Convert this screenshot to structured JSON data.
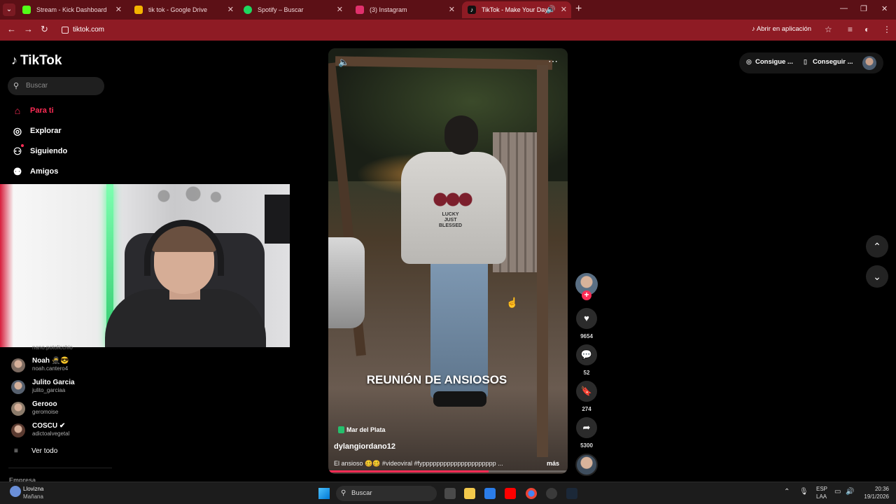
{
  "browser": {
    "tabs": [
      {
        "label": "Stream - Kick Dashboard",
        "favicon_color": "#53fc18"
      },
      {
        "label": "tik tok - Google Drive",
        "favicon_color": "#f4b400"
      },
      {
        "label": "Spotify – Buscar",
        "favicon_color": "#1ed760"
      },
      {
        "label": "(3) Instagram",
        "favicon_color": "#e1306c"
      },
      {
        "label": "TikTok - Make Your Day",
        "favicon_color": "#111111"
      }
    ],
    "url": "tiktok.com",
    "open_app_label": "Abrir en aplicación",
    "theme_color": "#8e1b24"
  },
  "sidebar": {
    "logo": "TikTok",
    "search_placeholder": "Buscar",
    "nav": [
      {
        "label": "Para ti",
        "icon": "home-icon"
      },
      {
        "label": "Explorar",
        "icon": "compass-icon"
      },
      {
        "label": "Siguiendo",
        "icon": "following-icon"
      },
      {
        "label": "Amigos",
        "icon": "friends-icon"
      }
    ],
    "faded_username": "nano.potolicchio",
    "accounts": [
      {
        "name": "Noah 🥷😎",
        "username": "noah.cantero4"
      },
      {
        "name": "Julito Garcia",
        "username": "julito_garciaa"
      },
      {
        "name": "Gerooo",
        "username": "geromoise"
      },
      {
        "name": "COSCU ✔",
        "username": "adictoalvegetal"
      }
    ],
    "see_all": "Ver todo",
    "section_label": "Empresa"
  },
  "video": {
    "caption": "REUNIÓN DE ANSIOSOS",
    "location": "Mar del Plata",
    "username": "dylangiordano12",
    "description": "El ansioso 🥴🥴 #videoviral #fyppppppppppppppppppppp ...",
    "more_label": "más",
    "shirt_text": "LUCKY\nJUST\nBLESSED",
    "progress": 0.67,
    "accent_color": "#fe2c55"
  },
  "actions": {
    "likes": "9654",
    "comments": "52",
    "saves": "274",
    "shares": "5300"
  },
  "topright": {
    "btn1": "Consigue ...",
    "btn2": "Conseguir ..."
  },
  "taskbar": {
    "weather_title": "Llovizna",
    "weather_sub": "Mañana",
    "search_placeholder": "Buscar",
    "lang1": "ESP",
    "lang2": "LAA",
    "time": "20:36",
    "date": "19/1/2026"
  }
}
